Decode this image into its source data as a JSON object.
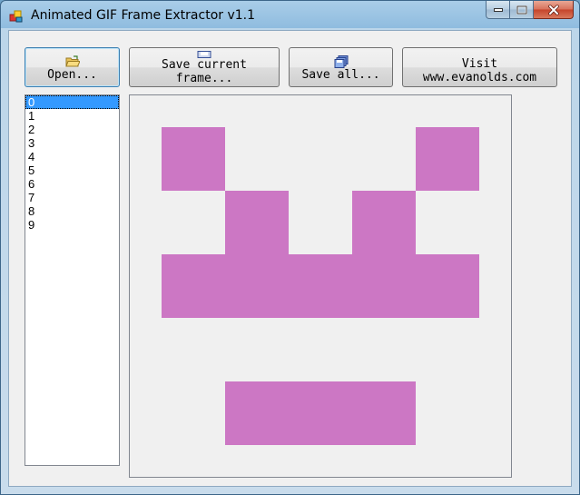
{
  "window": {
    "title": "Animated GIF Frame Extractor v1.1",
    "icons": {
      "app": "app-icon",
      "minimize": "minimize-icon",
      "maximize": "maximize-icon",
      "close": "close-icon"
    }
  },
  "toolbar": {
    "open_label": "Open...",
    "open_icon": "open-folder-icon",
    "save_current_label": "Save current\nframe...",
    "save_current_icon": "save-icon",
    "save_all_label": "Save all...",
    "save_all_icon": "save-all-icon",
    "visit_label": "Visit\nwww.evanolds.com"
  },
  "frames": {
    "items": [
      "0",
      "1",
      "2",
      "3",
      "4",
      "5",
      "6",
      "7",
      "8",
      "9"
    ],
    "selected_index": 0
  },
  "preview": {
    "pixel_color": "#cc77c4",
    "background_color": "#f0f0f0"
  },
  "colors": {
    "selection": "#3399ff",
    "window_background": "#f0f0f0"
  }
}
